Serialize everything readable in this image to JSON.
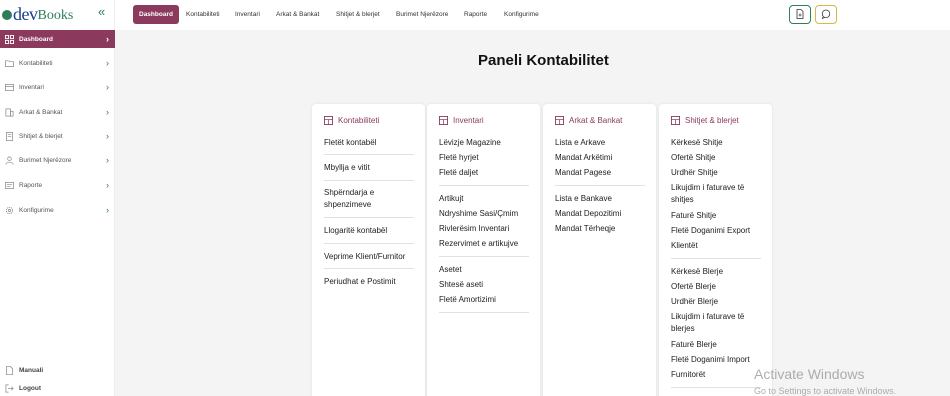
{
  "brand": {
    "dev": "dev",
    "books": "Books"
  },
  "sidebar": {
    "collapse_icon": "«",
    "items": [
      {
        "label": "Dashboard",
        "icon": "grid-icon"
      },
      {
        "label": "Kontabiliteti",
        "icon": "folder-icon"
      },
      {
        "label": "Inventari",
        "icon": "box-icon"
      },
      {
        "label": "Arkat & Bankat",
        "icon": "bank-icon"
      },
      {
        "label": "Shitjet & blerjet",
        "icon": "receipt-icon"
      },
      {
        "label": "Burimet Njerëzore",
        "icon": "users-icon"
      },
      {
        "label": "Raporte",
        "icon": "report-icon"
      },
      {
        "label": "Konfigurime",
        "icon": "gear-icon"
      }
    ],
    "bottom": [
      {
        "label": "Manuali",
        "icon": "document-icon"
      },
      {
        "label": "Logout",
        "icon": "logout-icon"
      }
    ]
  },
  "topnav": {
    "tabs": [
      "Dashboard",
      "Kontabiliteti",
      "Inventari",
      "Arkat & Bankat",
      "Shitjet & blerjet",
      "Burimet Njerëzore",
      "Raporte",
      "Konfigurime"
    ]
  },
  "main": {
    "title": "Paneli Kontabilitet",
    "cards": [
      {
        "title": "Kontabiliteti",
        "links": [
          "Fletët kontabël",
          "Mbyllja e vitit",
          "Shpërndarja e shpenzimeve",
          "Llogaritë kontabël",
          "Veprime Klient/Furnitor",
          "Periudhat e Postimit"
        ]
      },
      {
        "title": "Inventari",
        "links": [
          "Lëvizje Magazine",
          "Fletë hyrjet",
          "Fletë daljet",
          "Artikujt",
          "Ndryshime Sasi/Çmim",
          "Rivlerësim Inventari",
          "Rezervimet e artikujve",
          "Asetet",
          "Shtesë aseti",
          "Fletë Amortizimi"
        ]
      },
      {
        "title": "Arkat & Bankat",
        "links": [
          "Lista e Arkave",
          "Mandat Arkëtimi",
          "Mandat Pagese",
          "Lista e Bankave",
          "Mandat Depozitimi",
          "Mandat Tërheqje"
        ]
      },
      {
        "title": "Shitjet & blerjet",
        "links": [
          "Kërkesë Shitje",
          "Ofertë Shitje",
          "Urdhër Shitje",
          "Likujdim i faturave të shitjes",
          "Faturë Shitje",
          "Fletë Doganimi Export",
          "Klientët",
          "Kërkesë Blerje",
          "Ofertë Blerje",
          "Urdhër Blerje",
          "Likujdim i faturave të blerjes",
          "Faturë Blerje",
          "Fletë Doganimi Import",
          "Furnitorët"
        ]
      }
    ]
  },
  "watermark": {
    "line1": "Activate Windows",
    "line2": "Go to Settings to activate Windows."
  },
  "colors": {
    "accent": "#8b3a5e",
    "brand_green": "#2e7d5b",
    "brand_blue": "#1a3d8f"
  }
}
